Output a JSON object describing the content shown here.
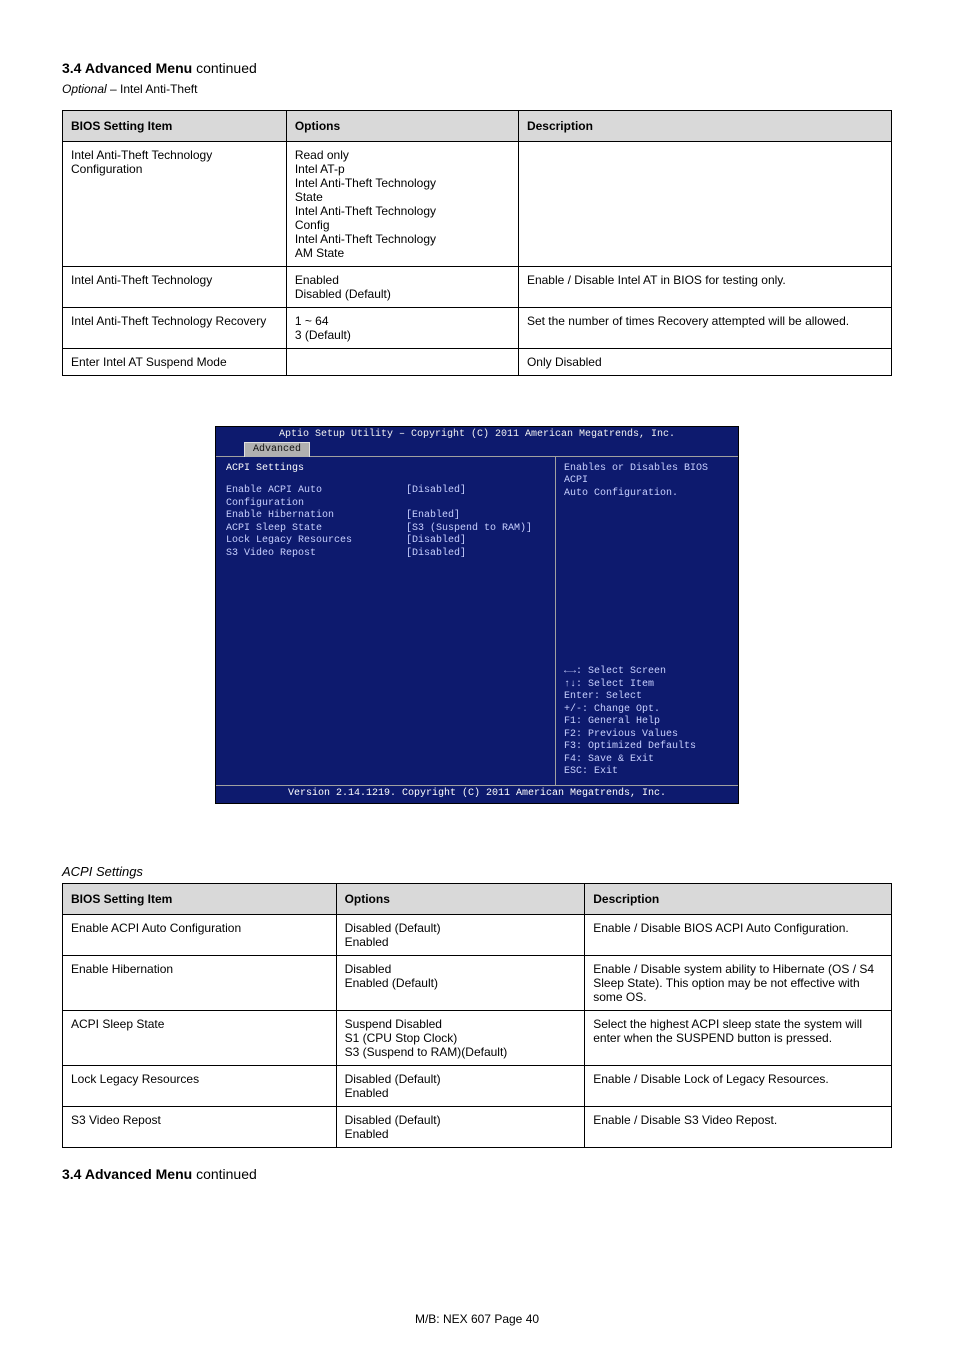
{
  "header": {
    "title_prefix": "3.4 Advanced Menu",
    "title_suffix": " continued",
    "subtitle_optional": "Optional",
    "subtitle_rest": " – Intel Anti-Theft"
  },
  "table1": {
    "headers": {
      "item": "BIOS Setting Item",
      "opts": "Options",
      "desc": "Description"
    },
    "rows": [
      {
        "item": "Intel Anti-Theft Technology Configuration",
        "opts_lines": [
          "Read only",
          "Intel AT-p",
          "Intel Anti-Theft Technology",
          "   State",
          "Intel Anti-Theft Technology",
          "   Config",
          "Intel Anti-Theft Technology",
          "   AM State"
        ],
        "desc_lines": [
          ""
        ]
      },
      {
        "item": "Intel Anti-Theft Technology",
        "opts_lines": [
          "Enabled",
          "Disabled (Default)"
        ],
        "desc_lines": [
          "Enable / Disable Intel AT in BIOS for testing only."
        ]
      },
      {
        "item": "Intel Anti-Theft Technology Recovery",
        "opts_lines": [
          "1 ~ 64",
          "3 (Default)"
        ],
        "desc_lines": [
          "Set the number of times Recovery attempted will be allowed."
        ]
      },
      {
        "item": "Enter Intel AT Suspend Mode",
        "opts_lines": [
          ""
        ],
        "desc_lines": [
          "Only Disabled"
        ]
      }
    ]
  },
  "bios": {
    "topbar": "Aptio Setup Utility – Copyright (C) 2011 American Megatrends, Inc.",
    "tab": "Advanced",
    "left_heading": "ACPI Settings",
    "rows": [
      {
        "label": "Enable ACPI Auto Configuration",
        "value": "[Disabled]"
      },
      {
        "label": "",
        "value": ""
      },
      {
        "label": "Enable Hibernation",
        "value": "[Enabled]"
      },
      {
        "label": "ACPI Sleep State",
        "value": "[S3 (Suspend to RAM)]"
      },
      {
        "label": "Lock Legacy Resources",
        "value": "[Disabled]"
      },
      {
        "label": "S3 Video Repost",
        "value": "[Disabled]"
      }
    ],
    "help_top_1": "Enables or Disables BIOS ACPI",
    "help_top_2": "Auto Configuration.",
    "keys": [
      "←→: Select Screen",
      "↑↓: Select Item",
      "Enter: Select",
      "+/-: Change Opt.",
      "F1: General Help",
      "F2: Previous Values",
      "F3: Optimized Defaults",
      "F4: Save & Exit",
      "ESC: Exit"
    ],
    "footer": "Version 2.14.1219. Copyright (C) 2011 American Megatrends, Inc."
  },
  "section_title": "ACPI Settings",
  "table2": {
    "headers": {
      "item": "BIOS Setting Item",
      "opts": "Options",
      "desc": "Description"
    },
    "rows": [
      {
        "item": "Enable ACPI Auto Configuration",
        "opts_lines": [
          "Disabled (Default)",
          "Enabled"
        ],
        "desc_lines": [
          "Enable / Disable BIOS ACPI Auto Configuration."
        ]
      },
      {
        "item": "Enable Hibernation",
        "opts_lines": [
          "Disabled",
          "Enabled (Default)"
        ],
        "desc_lines": [
          "Enable / Disable system ability to Hibernate (OS / S4 Sleep State). This option may be not effective with some OS."
        ]
      },
      {
        "item": "ACPI Sleep State",
        "opts_lines": [
          "Suspend Disabled",
          "S1 (CPU Stop Clock)",
          "S3 (Suspend to RAM)(Default)"
        ],
        "desc_lines": [
          "Select the highest ACPI sleep state the system will enter when the SUSPEND button is pressed."
        ]
      },
      {
        "item": "Lock Legacy Resources",
        "opts_lines": [
          "Disabled (Default)",
          "Enabled"
        ],
        "desc_lines": [
          "Enable / Disable Lock of Legacy Resources."
        ]
      },
      {
        "item": "S3 Video Repost",
        "opts_lines": [
          "Disabled (Default)",
          "Enabled"
        ],
        "desc_lines": [
          "Enable / Disable S3 Video Repost."
        ]
      }
    ]
  },
  "doc_footer": {
    "title_prefix": "3.4 Advanced Menu",
    "title_suffix": " continued"
  },
  "page_footer": {
    "product": "M/B: NEX 607 ",
    "pagelabel": "Page 40"
  }
}
